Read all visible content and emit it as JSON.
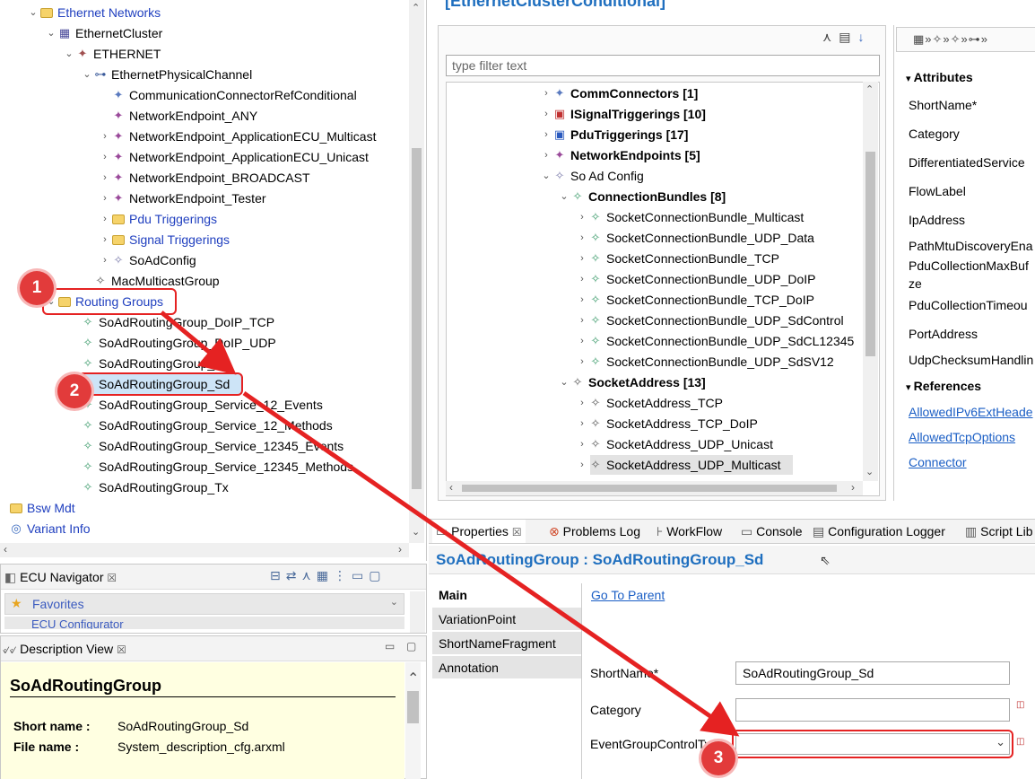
{
  "tree": {
    "items": [
      {
        "label": "Ethernet Networks",
        "indent": 1
      },
      {
        "label": "EthernetCluster"
      },
      {
        "label": "ETHERNET"
      },
      {
        "label": "EthernetPhysicalChannel"
      },
      {
        "label": "CommunicationConnectorRefConditional"
      },
      {
        "label": "NetworkEndpoint_ANY"
      },
      {
        "label": "NetworkEndpoint_ApplicationECU_Multicast"
      },
      {
        "label": "NetworkEndpoint_ApplicationECU_Unicast"
      },
      {
        "label": "NetworkEndpoint_BROADCAST"
      },
      {
        "label": "NetworkEndpoint_Tester"
      },
      {
        "label": "Pdu Triggerings"
      },
      {
        "label": "Signal Triggerings"
      },
      {
        "label": "SoAdConfig"
      },
      {
        "label": "MacMulticastGroup"
      },
      {
        "label": "Routing Groups"
      },
      {
        "label": "SoAdRoutingGroup_DoIP_TCP"
      },
      {
        "label": "SoAdRoutingGroup_DoIP_UDP"
      },
      {
        "label": "SoAdRoutingGroup_Rx"
      },
      {
        "label": "SoAdRoutingGroup_Sd"
      },
      {
        "label": "SoAdRoutingGroup_Service_12_Events"
      },
      {
        "label": "SoAdRoutingGroup_Service_12_Methods"
      },
      {
        "label": "SoAdRoutingGroup_Service_12345_Events"
      },
      {
        "label": "SoAdRoutingGroup_Service_12345_Methods"
      },
      {
        "label": "SoAdRoutingGroup_Tx"
      },
      {
        "label": "Bsw Mdt"
      },
      {
        "label": "Variant Info"
      }
    ]
  },
  "ecu_navigator": {
    "tab": "ECU Navigator",
    "favorites": "Favorites",
    "ecu_configurator": "ECU Configurator"
  },
  "description_view": {
    "tab": "Description View",
    "title": "SoAdRoutingGroup",
    "short_name_label": "Short name :",
    "short_name_value": "SoAdRoutingGroup_Sd",
    "file_name_label": "File name :",
    "file_name_value": "System_description_cfg.arxml"
  },
  "editor": {
    "title": "[EthernetClusterConditional]",
    "filter_placeholder": "type filter text",
    "items": [
      {
        "label": "CommConnectors [1]"
      },
      {
        "label": "ISignalTriggerings [10]"
      },
      {
        "label": "PduTriggerings [17]"
      },
      {
        "label": "NetworkEndpoints [5]"
      },
      {
        "label": "So Ad Config"
      },
      {
        "label": "ConnectionBundles [8]"
      },
      {
        "label": "SocketConnectionBundle_Multicast"
      },
      {
        "label": "SocketConnectionBundle_UDP_Data"
      },
      {
        "label": "SocketConnectionBundle_TCP"
      },
      {
        "label": "SocketConnectionBundle_UDP_DoIP"
      },
      {
        "label": "SocketConnectionBundle_TCP_DoIP"
      },
      {
        "label": "SocketConnectionBundle_UDP_SdControl"
      },
      {
        "label": "SocketConnectionBundle_UDP_SdCL12345"
      },
      {
        "label": "SocketConnectionBundle_UDP_SdSV12"
      },
      {
        "label": "SocketAddress [13]"
      },
      {
        "label": "SocketAddress_TCP"
      },
      {
        "label": "SocketAddress_TCP_DoIP"
      },
      {
        "label": "SocketAddress_UDP_Unicast"
      },
      {
        "label": "SocketAddress_UDP_Multicast"
      }
    ],
    "attributes_header": "Attributes",
    "attributes": [
      "ShortName*",
      "Category",
      "DifferentiatedService",
      "FlowLabel",
      "IpAddress",
      "PathMtuDiscoveryEna",
      "PduCollectionMaxBuf",
      "ze",
      "PduCollectionTimeou",
      "PortAddress",
      "UdpChecksumHandlin"
    ],
    "references_header": "References",
    "references": [
      "AllowedIPv6ExtHeade",
      "AllowedTcpOptions",
      "Connector"
    ]
  },
  "bottom_tabs": [
    "Properties",
    "Problems Log",
    "WorkFlow",
    "Console",
    "Configuration Logger",
    "Script Lib"
  ],
  "properties": {
    "title": "SoAdRoutingGroup : SoAdRoutingGroup_Sd",
    "side_tabs": [
      "Main",
      "VariationPoint",
      "ShortNameFragment",
      "Annotation"
    ],
    "go_to_parent": "Go To Parent",
    "short_name_label": "ShortName*",
    "short_name_value": "SoAdRoutingGroup_Sd",
    "category_label": "Category",
    "category_value": "",
    "event_group_label": "EventGroupControlType",
    "event_group_value": ""
  },
  "annotations": {
    "badge1": "1",
    "badge2": "2",
    "badge3": "3"
  },
  "colors": {
    "accent_red": "#e52222",
    "link_blue": "#1a5ec5",
    "title_blue": "#1f6fbf",
    "selection": "#cde4f7"
  }
}
